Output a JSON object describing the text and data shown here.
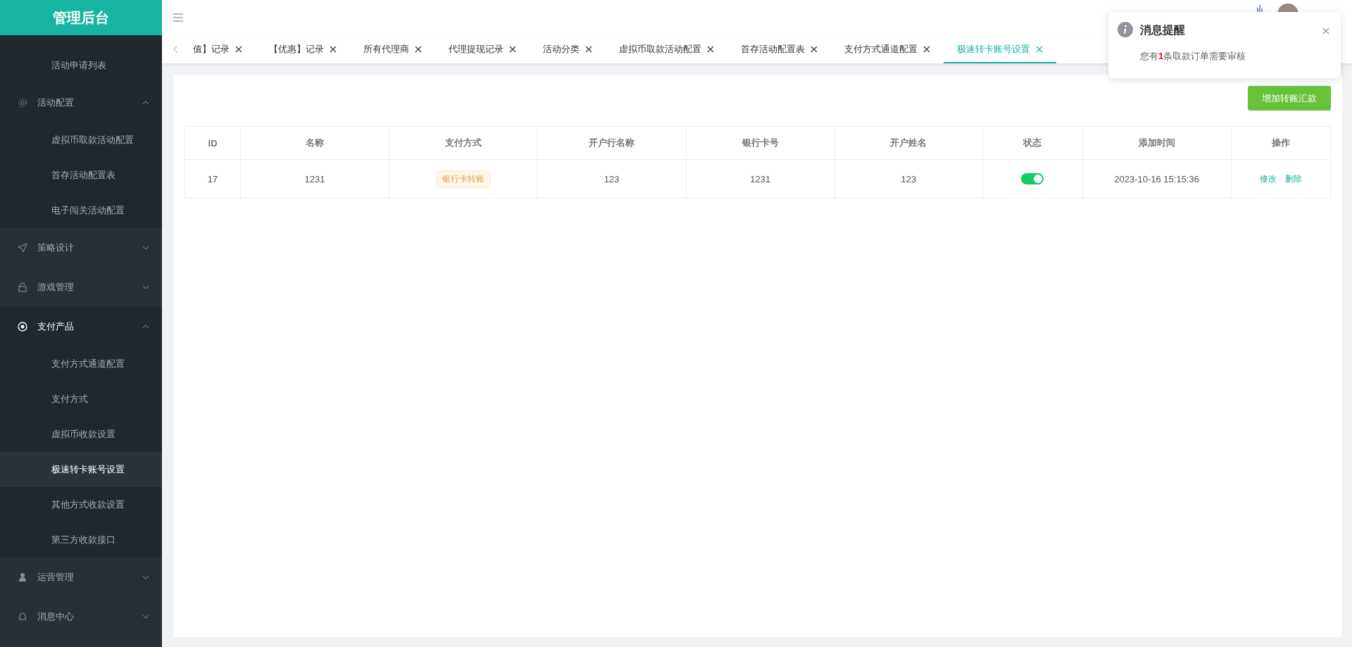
{
  "sidebar": {
    "title": "管理后台",
    "items": [
      {
        "kind": "leaf",
        "label": "活动申请列表",
        "selected": false
      },
      {
        "kind": "group",
        "label": "活动配置",
        "expanded": true,
        "children": [
          {
            "label": "虚拟币取款活动配置",
            "selected": false
          },
          {
            "label": "首存活动配置表",
            "selected": false
          },
          {
            "label": "电子闯关活动配置",
            "selected": false
          }
        ]
      },
      {
        "kind": "group",
        "label": "策略设计",
        "expanded": false
      },
      {
        "kind": "group",
        "label": "游戏管理",
        "expanded": false
      },
      {
        "kind": "group",
        "label": "支付产品",
        "expanded": true,
        "children": [
          {
            "label": "支付方式通道配置",
            "selected": false
          },
          {
            "label": "支付方式",
            "selected": false
          },
          {
            "label": "虚拟币收款设置",
            "selected": false
          },
          {
            "label": "极速转卡账号设置",
            "selected": true
          },
          {
            "label": "其他方式收款设置",
            "selected": false
          },
          {
            "label": "第三方收款接口",
            "selected": false
          }
        ]
      },
      {
        "kind": "group",
        "label": "运营管理",
        "expanded": false
      },
      {
        "kind": "group",
        "label": "消息中心",
        "expanded": false
      }
    ]
  },
  "tabs": [
    {
      "label": "值】记录",
      "selected": false
    },
    {
      "label": "【优惠】记录",
      "selected": false
    },
    {
      "label": "所有代理商",
      "selected": false
    },
    {
      "label": "代理提现记录",
      "selected": false
    },
    {
      "label": "活动分类",
      "selected": false
    },
    {
      "label": "虚拟币取款活动配置",
      "selected": false
    },
    {
      "label": "首存活动配置表",
      "selected": false
    },
    {
      "label": "支付方式通道配置",
      "selected": false
    },
    {
      "label": "极速转卡账号设置",
      "selected": true
    }
  ],
  "add_button": "增加转账汇款",
  "table": {
    "columns": [
      "ID",
      "名称",
      "支付方式",
      "开户行名称",
      "银行卡号",
      "开户姓名",
      "状态",
      "添加时间",
      "操作"
    ],
    "rows": [
      {
        "id": "17",
        "name": "1231",
        "payment_tag": "银行卡转账",
        "bank_name": "123",
        "card_number": "1231",
        "holder": "123",
        "status_on": true,
        "added": "2023-10-16 15:15:36",
        "actions": [
          "修改",
          "删除"
        ]
      }
    ]
  },
  "notification": {
    "title": "消息提醒",
    "message": "您有**1**条取款订单需要审核"
  }
}
